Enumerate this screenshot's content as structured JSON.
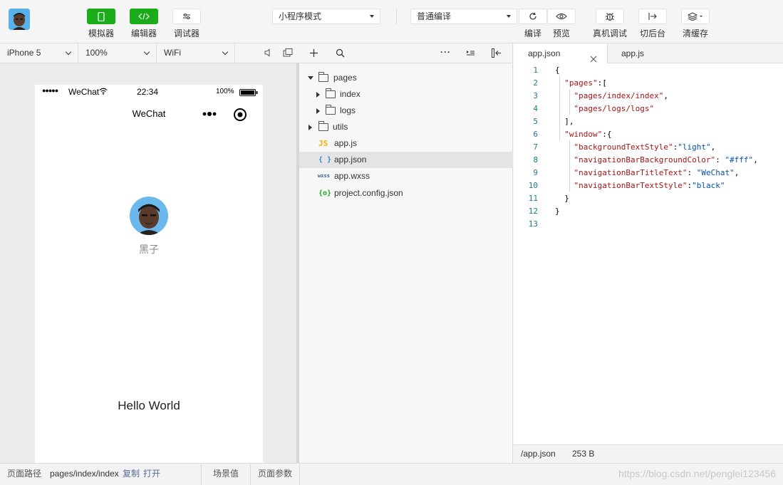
{
  "toolbar": {
    "simulator_label": "模拟器",
    "editor_label": "编辑器",
    "debugger_label": "调试器",
    "mode_select": "小程序模式",
    "compile_select": "普通编译",
    "compile_label": "编译",
    "preview_label": "预览",
    "remote_debug_label": "真机调试",
    "background_label": "切后台",
    "clear_cache_label": "清缓存"
  },
  "simulator_bar": {
    "device": "iPhone 5",
    "zoom": "100%",
    "network": "WiFi"
  },
  "phone": {
    "carrier": "WeChat",
    "time": "22:34",
    "battery": "100%",
    "nav_title": "WeChat",
    "user_name": "黑子",
    "hello_text": "Hello World"
  },
  "file_tree": {
    "items": [
      {
        "label": "pages"
      },
      {
        "label": "index"
      },
      {
        "label": "logs"
      },
      {
        "label": "utils"
      },
      {
        "label": "app.js",
        "icon_text": "JS"
      },
      {
        "label": "app.json",
        "icon_text": "{ }"
      },
      {
        "label": "app.wxss",
        "icon_text": "wxss"
      },
      {
        "label": "project.config.json",
        "icon_text": "{o}"
      }
    ]
  },
  "editor": {
    "tabs": [
      {
        "label": "app.json"
      },
      {
        "label": "app.js"
      }
    ],
    "line_numbers": [
      "1",
      "2",
      "3",
      "4",
      "5",
      "6",
      "7",
      "8",
      "9",
      "10",
      "11",
      "12",
      "13"
    ],
    "status_path": "/app.json",
    "status_size": "253 B"
  },
  "bottom_bar": {
    "path_label": "页面路径",
    "path_value": "pages/index/index",
    "copy_label": "复制",
    "open_label": "打开",
    "scene_label": "场景值",
    "params_label": "页面参数",
    "watermark": "https://blog.csdn.net/penglei123456"
  },
  "colors": {
    "accent_green": "#1aad19",
    "link_blue": "#576b95"
  }
}
